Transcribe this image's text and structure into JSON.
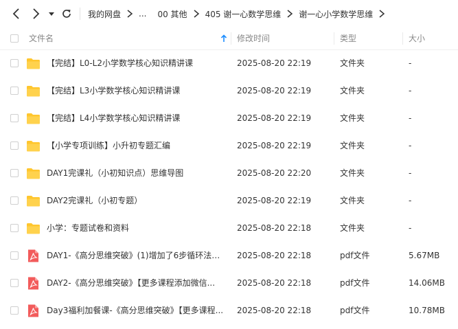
{
  "breadcrumb": [
    "我的网盘",
    "...",
    "00 其他",
    "405 谢一心数学思维",
    "谢一心小学数学思维"
  ],
  "columns": {
    "name": "文件名",
    "mtime": "修改时间",
    "type": "类型",
    "size": "大小"
  },
  "colors": {
    "folder": "#ffc62e",
    "pdf": "#f25b5b",
    "sort_arrow": "#1a8cff"
  },
  "files": [
    {
      "icon": "folder-icon",
      "name": "【完结】L0-L2小学数学核心知识精讲课",
      "mtime": "2025-08-20 22:19",
      "type": "文件夹",
      "size": "-"
    },
    {
      "icon": "folder-icon",
      "name": "【完结】L3小学数学核心知识精讲课",
      "mtime": "2025-08-20 22:19",
      "type": "文件夹",
      "size": "-"
    },
    {
      "icon": "folder-icon",
      "name": "【完结】L4小学数学核心知识精讲课",
      "mtime": "2025-08-20 22:19",
      "type": "文件夹",
      "size": "-"
    },
    {
      "icon": "folder-icon",
      "name": "【小学专项训练】小升初专题汇编",
      "mtime": "2025-08-20 22:19",
      "type": "文件夹",
      "size": "-"
    },
    {
      "icon": "folder-icon",
      "name": "DAY1完课礼（小初知识点）思维导图",
      "mtime": "2025-08-20 22:20",
      "type": "文件夹",
      "size": "-"
    },
    {
      "icon": "folder-icon",
      "name": "DAY2完课礼（小初专题）",
      "mtime": "2025-08-20 22:19",
      "type": "文件夹",
      "size": "-"
    },
    {
      "icon": "folder-icon",
      "name": "小学：专题试卷和资料",
      "mtime": "2025-08-20 22:18",
      "type": "文件夹",
      "size": "-"
    },
    {
      "icon": "pdf-icon",
      "name": "DAY1-《高分思维突破》(1)增加了6步循环法【...",
      "mtime": "2025-08-20 22:18",
      "type": "pdf文件",
      "size": "5.67MB"
    },
    {
      "icon": "pdf-icon",
      "name": "DAY2-《高分思维突破》【更多课程添加微信...",
      "mtime": "2025-08-20 22:18",
      "type": "pdf文件",
      "size": "14.06MB"
    },
    {
      "icon": "pdf-icon",
      "name": "Day3福利加餐课-《高分思维突破》【更多课程...",
      "mtime": "2025-08-20 22:18",
      "type": "pdf文件",
      "size": "10.78MB"
    }
  ]
}
